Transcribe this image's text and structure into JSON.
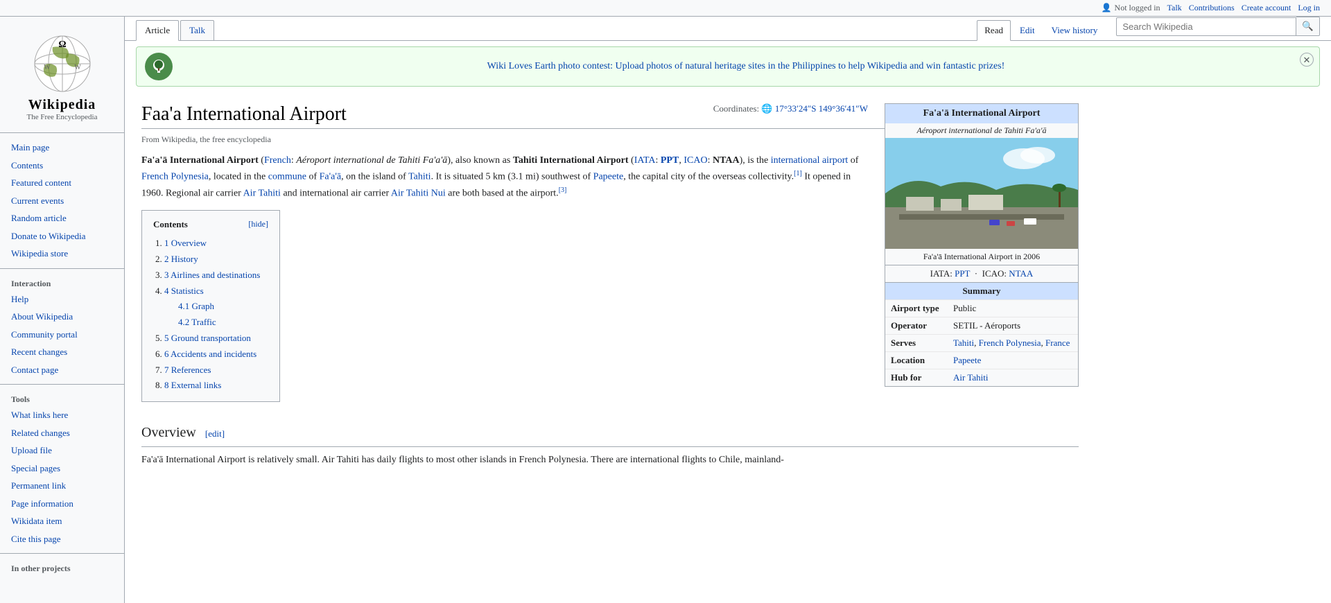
{
  "topbar": {
    "not_logged_in": "Not logged in",
    "talk": "Talk",
    "contributions": "Contributions",
    "create_account": "Create account",
    "log_in": "Log in",
    "user_icon": "👤"
  },
  "sidebar": {
    "logo_text": "Wikipedia",
    "logo_tagline": "The Free Encyclopedia",
    "nav_items": [
      {
        "label": "Main page",
        "id": "main-page"
      },
      {
        "label": "Contents",
        "id": "contents"
      },
      {
        "label": "Featured content",
        "id": "featured-content"
      },
      {
        "label": "Current events",
        "id": "current-events"
      },
      {
        "label": "Random article",
        "id": "random-article"
      },
      {
        "label": "Donate to Wikipedia",
        "id": "donate"
      },
      {
        "label": "Wikipedia store",
        "id": "store"
      }
    ],
    "interaction_heading": "Interaction",
    "interaction_items": [
      {
        "label": "Help",
        "id": "help"
      },
      {
        "label": "About Wikipedia",
        "id": "about"
      },
      {
        "label": "Community portal",
        "id": "community-portal"
      },
      {
        "label": "Recent changes",
        "id": "recent-changes"
      },
      {
        "label": "Contact page",
        "id": "contact"
      }
    ],
    "tools_heading": "Tools",
    "tools_items": [
      {
        "label": "What links here",
        "id": "what-links"
      },
      {
        "label": "Related changes",
        "id": "related-changes"
      },
      {
        "label": "Upload file",
        "id": "upload-file"
      },
      {
        "label": "Special pages",
        "id": "special-pages"
      },
      {
        "label": "Permanent link",
        "id": "permanent-link"
      },
      {
        "label": "Page information",
        "id": "page-info"
      },
      {
        "label": "Wikidata item",
        "id": "wikidata"
      },
      {
        "label": "Cite this page",
        "id": "cite"
      }
    ],
    "other_projects_heading": "In other projects"
  },
  "header": {
    "article_tab": "Article",
    "talk_tab": "Talk",
    "read_tab": "Read",
    "edit_tab": "Edit",
    "view_history_tab": "View history",
    "search_placeholder": "Search Wikipedia"
  },
  "banner": {
    "text": "Wiki Loves Earth photo contest: Upload photos of natural heritage sites in the Philippines to help Wikipedia and win fantastic prizes!",
    "close_label": "✕"
  },
  "article": {
    "title": "Faa'a International Airport",
    "from_text": "From Wikipedia, the free encyclopedia",
    "coordinates_label": "Coordinates:",
    "coordinates_globe": "🌐",
    "coordinates_value": "17°33′24″S 149°36′41″W",
    "intro": {
      "bold_start": "Fa'a'ā International Airport",
      "french_label": "French:",
      "french_italic": "Aéroport international de Tahiti Fa'a'ā",
      "also_known": ", also known as ",
      "tahiti_bold": "Tahiti International Airport",
      "iata_label": "IATA:",
      "iata_code": "PPT",
      "icao_label": "ICAO:",
      "icao_code": "NTAA",
      "rest": "), is the international airport of French Polynesia, located in the commune of Fa'a'ā, on the island of Tahiti. It is situated 5 km (3.1 mi) southwest of Papeete, the capital city of the overseas collectivity.",
      "ref1": "[1]",
      "opened": " It opened in 1960. Regional air carrier Air Tahiti and international air carrier Air Tahiti Nui are both based at the airport.",
      "ref3": "[3]"
    },
    "toc": {
      "title": "Contents",
      "hide_label": "hide",
      "items": [
        {
          "num": "1",
          "label": "Overview",
          "sub": []
        },
        {
          "num": "2",
          "label": "History",
          "sub": []
        },
        {
          "num": "3",
          "label": "Airlines and destinations",
          "sub": []
        },
        {
          "num": "4",
          "label": "Statistics",
          "sub": [
            {
              "num": "4.1",
              "label": "Graph"
            },
            {
              "num": "4.2",
              "label": "Traffic"
            }
          ]
        },
        {
          "num": "5",
          "label": "Ground transportation",
          "sub": []
        },
        {
          "num": "6",
          "label": "Accidents and incidents",
          "sub": []
        },
        {
          "num": "7",
          "label": "References",
          "sub": []
        },
        {
          "num": "8",
          "label": "External links",
          "sub": []
        }
      ]
    },
    "overview_heading": "Overview",
    "overview_edit": "edit",
    "overview_text": "Fa'a'ā International Airport is relatively small. Air Tahiti has daily flights to most other islands in French Polynesia. There are international flights to Chile, mainland-"
  },
  "infobox": {
    "title": "Fa'a'ā International Airport",
    "subtitle": "Aéroport international de Tahiti Fa'a'ā",
    "image_caption": "Fa'a'ā International Airport in 2006",
    "iata_label": "IATA:",
    "iata_code": "PPT",
    "icao_label": "ICAO:",
    "icao_code": "NTAA",
    "summary_heading": "Summary",
    "rows": [
      {
        "key": "Airport type",
        "value": "Public"
      },
      {
        "key": "Operator",
        "value": "SETIL - Aéroports"
      },
      {
        "key": "Serves",
        "value": "Tahiti, French Polynesia, France"
      },
      {
        "key": "Location",
        "value": "Papeete"
      },
      {
        "key": "Hub for",
        "value": "Air Tahiti"
      }
    ]
  }
}
